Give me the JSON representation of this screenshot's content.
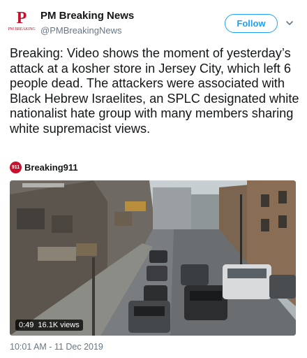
{
  "account": {
    "avatar_letter": "P",
    "avatar_caption": "PM BREAKING",
    "name": "PM Breaking News",
    "handle": "@PMBreakingNews"
  },
  "follow_label": "Follow",
  "tweet": {
    "text": "Breaking: Video shows the moment of yesterday’s attack at a kosher store in Jersey City, which left 6 people dead. The attackers were associated with Black Hebrew Israelites, an SPLC designated white nationalist hate group with many members sharing white supremacist views.",
    "timestamp": "10:01 AM - 11 Dec 2019"
  },
  "video": {
    "source_logo": "911",
    "source_name": "Breaking911",
    "duration": "0:49",
    "views": "16.1K views"
  },
  "colors": {
    "accent": "#1da1f2",
    "brand_red": "#c8102e",
    "text": "#14171a",
    "muted": "#657786"
  }
}
